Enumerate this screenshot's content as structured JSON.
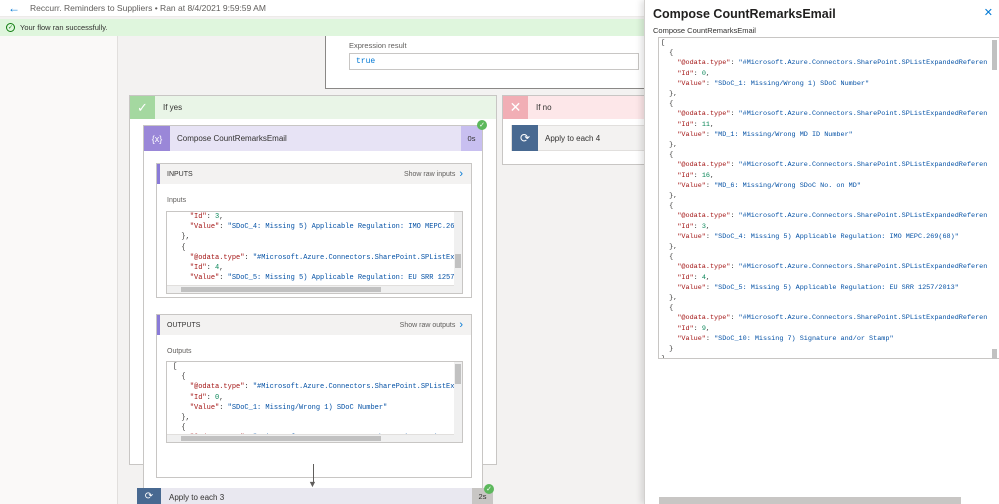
{
  "header": {
    "flow_title": "Reccurr. Reminders to Suppliers • Ran at 8/4/2021 9:59:59 AM",
    "back_icon": "back-arrow-icon"
  },
  "status": {
    "message": "Your flow ran successfully.",
    "color": "#dff6dd"
  },
  "expression": {
    "label": "Expression result",
    "value": "true"
  },
  "if_yes": {
    "label": "If yes",
    "color": "#a4d8a0"
  },
  "if_no": {
    "label": "If no",
    "color": "#f1aeb5",
    "action": {
      "label": "Apply to each 4"
    }
  },
  "compose": {
    "title": "Compose CountRemarksEmail",
    "duration": "0s",
    "icon_text": "{x}",
    "inputs": {
      "section_title": "INPUTS",
      "show_raw": "Show raw inputs",
      "label": "Inputs",
      "lines": [
        "    \"Id\": 3,",
        "    \"Value\": \"SDoC_4: Missing 5) Applicable Regulation: IMO MEPC.26",
        "  },",
        "  {",
        "    \"@odata.type\": \"#Microsoft.Azure.Connectors.SharePoint.SPListEx",
        "    \"Id\": 4,",
        "    \"Value\": \"SDoC_5: Missing 5) Applicable Regulation: EU SRR 1257"
      ]
    },
    "outputs": {
      "section_title": "OUTPUTS",
      "show_raw": "Show raw outputs",
      "label": "Outputs",
      "lines": [
        "[",
        "  {",
        "    \"@odata.type\": \"#Microsoft.Azure.Connectors.SharePoint.SPListEx",
        "    \"Id\": 0,",
        "    \"Value\": \"SDoC_1: Missing/Wrong 1) SDoC Number\"",
        "  },",
        "  {",
        "    \"@odata.type\": \"#Microsoft.Azure.Connectors.SharePoint.SPListEx"
      ]
    }
  },
  "apply3": {
    "label": "Apply to each 3",
    "duration": "2s"
  },
  "panel": {
    "title": "Compose CountRemarksEmail",
    "subtitle": "Compose CountRemarksEmail",
    "lines": [
      "[",
      "  {",
      "    \"@odata.type\": \"#Microsoft.Azure.Connectors.SharePoint.SPListExpandedReferen",
      "    \"Id\": 0,",
      "    \"Value\": \"SDoC_1: Missing/Wrong 1) SDoC Number\"",
      "  },",
      "  {",
      "    \"@odata.type\": \"#Microsoft.Azure.Connectors.SharePoint.SPListExpandedReferen",
      "    \"Id\": 11,",
      "    \"Value\": \"MD_1: Missing/Wrong MD ID Number\"",
      "  },",
      "  {",
      "    \"@odata.type\": \"#Microsoft.Azure.Connectors.SharePoint.SPListExpandedReferen",
      "    \"Id\": 16,",
      "    \"Value\": \"MD_6: Missing/Wrong SDoC No. on MD\"",
      "  },",
      "  {",
      "    \"@odata.type\": \"#Microsoft.Azure.Connectors.SharePoint.SPListExpandedReferen",
      "    \"Id\": 3,",
      "    \"Value\": \"SDoC_4: Missing 5) Applicable Regulation: IMO MEPC.269(68)\"",
      "  },",
      "  {",
      "    \"@odata.type\": \"#Microsoft.Azure.Connectors.SharePoint.SPListExpandedReferen",
      "    \"Id\": 4,",
      "    \"Value\": \"SDoC_5: Missing 5) Applicable Regulation: EU SRR 1257/2013\"",
      "  },",
      "  {",
      "    \"@odata.type\": \"#Microsoft.Azure.Connectors.SharePoint.SPListExpandedReferen",
      "    \"Id\": 9,",
      "    \"Value\": \"SDoC_10: Missing 7) Signature and/or Stamp\"",
      "  }",
      "]"
    ]
  }
}
